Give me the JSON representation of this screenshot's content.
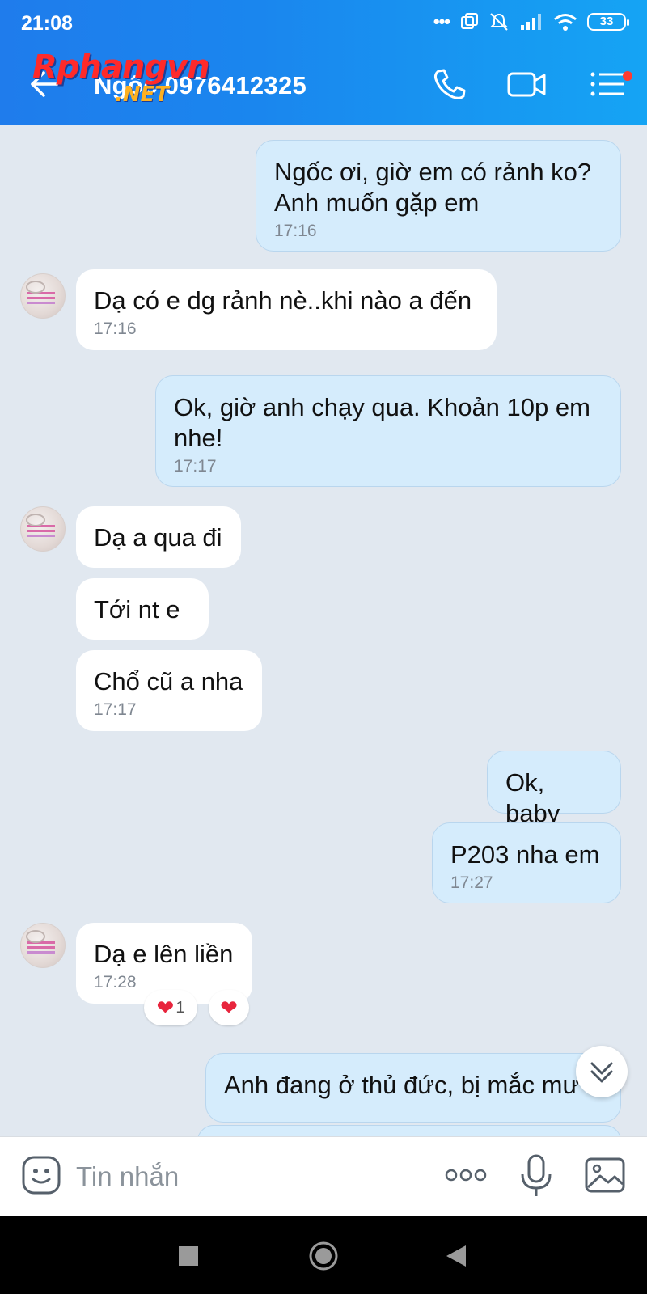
{
  "status_bar": {
    "time": "21:08",
    "dots": "•••",
    "battery": "33"
  },
  "header": {
    "contact_name": "Ngốc 0976412325",
    "watermark_main": "Rphangvn",
    "watermark_sub": ".NET",
    "accent_color": "#1a86ee"
  },
  "messages": [
    {
      "side": "out",
      "text": "Ngốc ơi, giờ em có rảnh ko? Anh muốn gặp em",
      "time": "17:16"
    },
    {
      "side": "in",
      "text": "Dạ có e dg rảnh nè..khi nào a đến",
      "time": "17:16"
    },
    {
      "side": "out",
      "text": "Ok, giờ anh chạy qua. Khoản 10p em nhe!",
      "time": "17:17"
    },
    {
      "side": "in",
      "text": "Dạ a qua đi",
      "time": ""
    },
    {
      "side": "in",
      "text": "Tới nt e",
      "time": ""
    },
    {
      "side": "in",
      "text": "Chổ cũ a nha",
      "time": "17:17"
    },
    {
      "side": "out",
      "text": "Ok, baby",
      "time": ""
    },
    {
      "side": "out",
      "text": "P203 nha em",
      "time": "17:27"
    },
    {
      "side": "in",
      "text": "Dạ e lên liền",
      "time": "17:28"
    },
    {
      "side": "out",
      "text": "Anh đang ở thủ đức, bị mắc mư",
      "time": ""
    }
  ],
  "reactions": {
    "count": "1",
    "heart_icon": "heart-icon"
  },
  "input_bar": {
    "placeholder": "Tin nhắn"
  }
}
